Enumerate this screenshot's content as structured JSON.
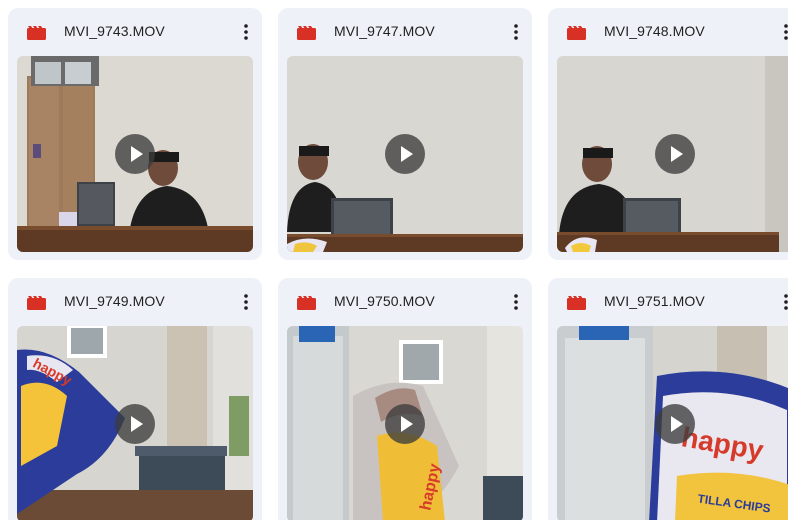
{
  "files": [
    {
      "name": "MVI_9743.MOV",
      "type_icon": "video-file-icon",
      "scene": "desk-door"
    },
    {
      "name": "MVI_9747.MOV",
      "type_icon": "video-file-icon",
      "scene": "desk-wall"
    },
    {
      "name": "MVI_9748.MOV",
      "type_icon": "video-file-icon",
      "scene": "desk-corner"
    },
    {
      "name": "MVI_9749.MOV",
      "type_icon": "video-file-icon",
      "scene": "chips-bag"
    },
    {
      "name": "MVI_9750.MOV",
      "type_icon": "video-file-icon",
      "scene": "bottle-chips"
    },
    {
      "name": "MVI_9751.MOV",
      "type_icon": "video-file-icon",
      "scene": "bottle-chips-close"
    }
  ],
  "colors": {
    "card_background": "#eef1f8",
    "video_icon": "#d93025",
    "text": "#1f1f1f",
    "play_button": "#3c3c3c"
  }
}
